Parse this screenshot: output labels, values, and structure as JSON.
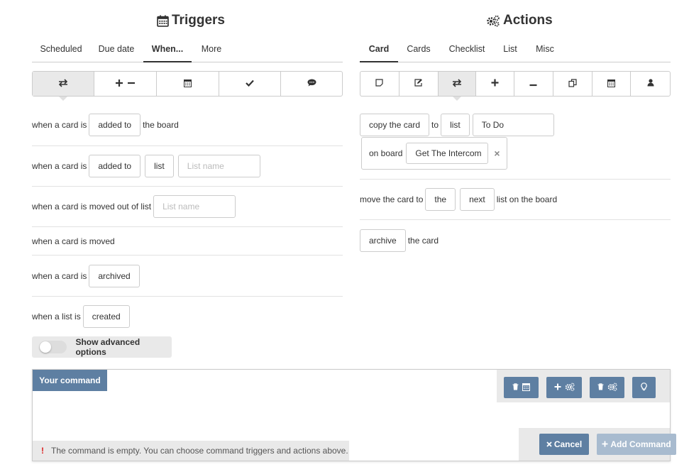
{
  "triggers": {
    "title": "Triggers",
    "tabs": [
      "Scheduled",
      "Due date",
      "When...",
      "More"
    ],
    "rows": {
      "r1": {
        "prefix": "when a card is",
        "box1": "added to",
        "suffix": "the board"
      },
      "r2": {
        "prefix": "when a card is",
        "box1": "added to",
        "box2": "list",
        "placeholder": "List name"
      },
      "r3": {
        "prefix": "when a card is moved out of list",
        "placeholder": "List name"
      },
      "r4": {
        "prefix": "when a card is moved"
      },
      "r5": {
        "prefix": "when a card is",
        "box1": "archived"
      },
      "r6": {
        "prefix": "when a list is",
        "box1": "created"
      }
    },
    "advanced_label": "Show advanced options"
  },
  "actions": {
    "title": "Actions",
    "tabs": [
      "Card",
      "Cards",
      "Checklist",
      "List",
      "Misc"
    ],
    "rows": {
      "r1": {
        "box1": "copy the card",
        "mid": "to",
        "box2": "list",
        "value": "To Do"
      },
      "r1b": {
        "prefix": "on board",
        "value": "Get The Intercom",
        "clear": "×"
      },
      "r2": {
        "prefix": "move the card to",
        "box1": "the",
        "box2": "next",
        "suffix": "list on the board"
      },
      "r3": {
        "box1": "archive",
        "suffix": "the card"
      }
    }
  },
  "command": {
    "tag": "Your command",
    "status": "The command is empty. You can choose command triggers and actions above.",
    "cancel": "Cancel",
    "add": "Add Command",
    "excl": "!"
  },
  "colors": {
    "primary": "#5e7fa2",
    "disabled": "#a8bbcf",
    "panel": "#e9e9e9"
  }
}
